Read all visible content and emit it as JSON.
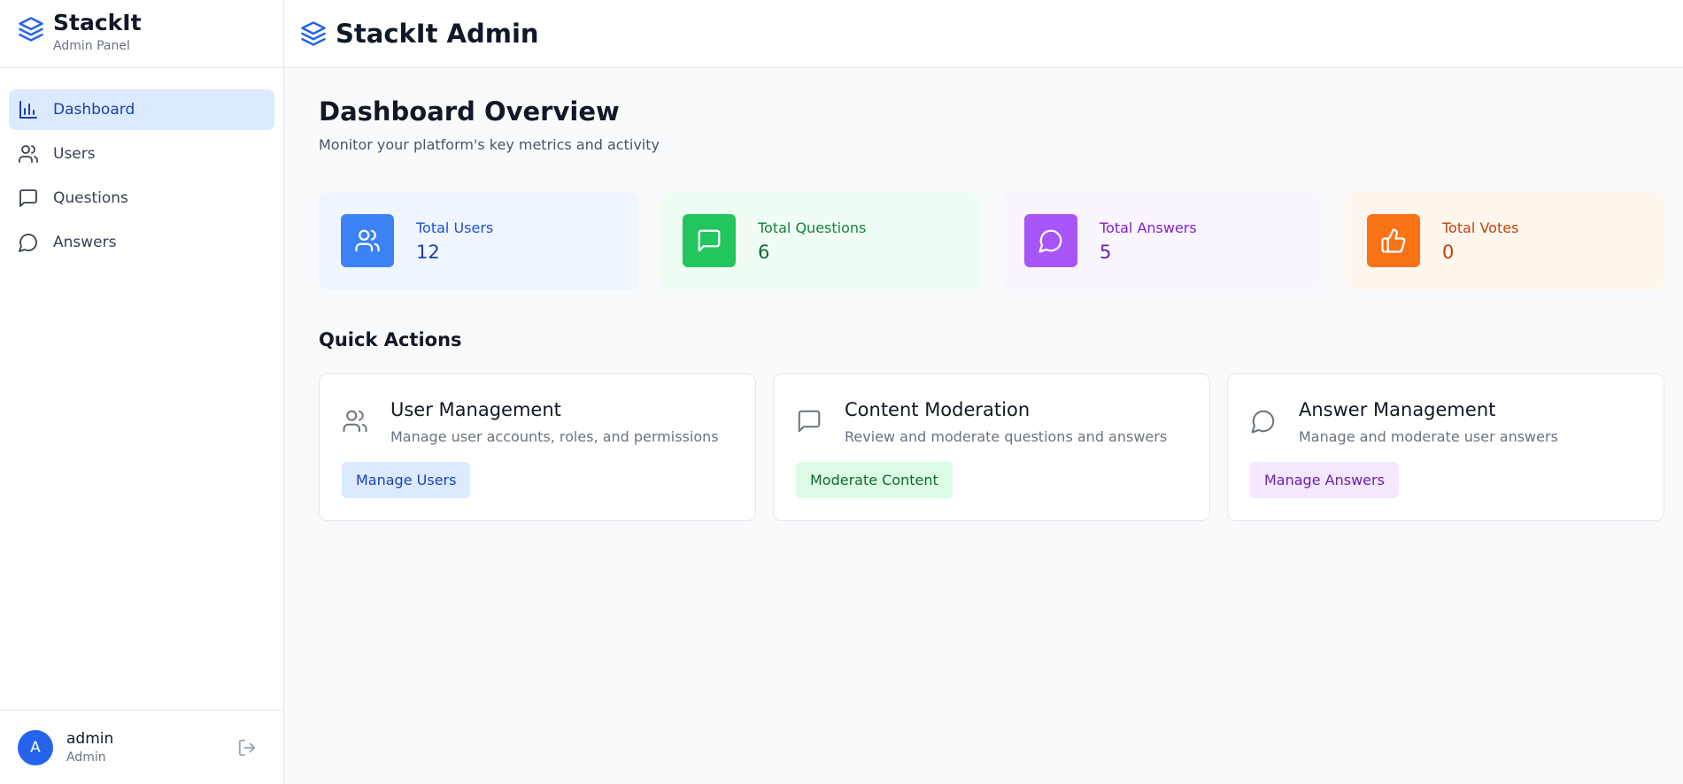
{
  "brand": {
    "name": "StackIt",
    "subtitle": "Admin Panel"
  },
  "nav": [
    {
      "label": "Dashboard",
      "icon": "bar-chart-icon",
      "active": true
    },
    {
      "label": "Users",
      "icon": "users-icon"
    },
    {
      "label": "Questions",
      "icon": "message-square-icon"
    },
    {
      "label": "Answers",
      "icon": "message-circle-icon"
    }
  ],
  "user": {
    "initial": "A",
    "name": "admin",
    "role": "Admin"
  },
  "header": {
    "title": "StackIt Admin"
  },
  "page": {
    "title": "Dashboard Overview",
    "subtitle": "Monitor your platform's key metrics and activity"
  },
  "stats": [
    {
      "label": "Total Users",
      "value": "12",
      "icon": "users-icon",
      "accent": "#3b82f6",
      "bg": "#eff6ff",
      "text": "#1d4ed8",
      "value_color": "#1e40af"
    },
    {
      "label": "Total Questions",
      "value": "6",
      "icon": "message-square-icon",
      "accent": "#22c55e",
      "bg": "#f0fdf4",
      "text": "#15803d",
      "value_color": "#166534"
    },
    {
      "label": "Total Answers",
      "value": "5",
      "icon": "message-circle-icon",
      "accent": "#a855f7",
      "bg": "#faf5ff",
      "text": "#7e22ce",
      "value_color": "#6b21a8"
    },
    {
      "label": "Total Votes",
      "value": "0",
      "icon": "thumbs-up-icon",
      "accent": "#f97316",
      "bg": "#fff7ed",
      "text": "#c2410c",
      "value_color": "#c2410c"
    }
  ],
  "quick_actions": {
    "title": "Quick Actions",
    "cards": [
      {
        "title": "User Management",
        "description": "Manage user accounts, roles, and permissions",
        "button": "Manage Users",
        "icon": "users-icon",
        "btn_bg": "#dbeafe",
        "btn_text": "#1e40af"
      },
      {
        "title": "Content Moderation",
        "description": "Review and moderate questions and answers",
        "button": "Moderate Content",
        "icon": "message-square-icon",
        "btn_bg": "#dcfce7",
        "btn_text": "#166534"
      },
      {
        "title": "Answer Management",
        "description": "Manage and moderate user answers",
        "button": "Manage Answers",
        "icon": "message-circle-icon",
        "btn_bg": "#f3e8ff",
        "btn_text": "#6b21a8"
      }
    ]
  }
}
